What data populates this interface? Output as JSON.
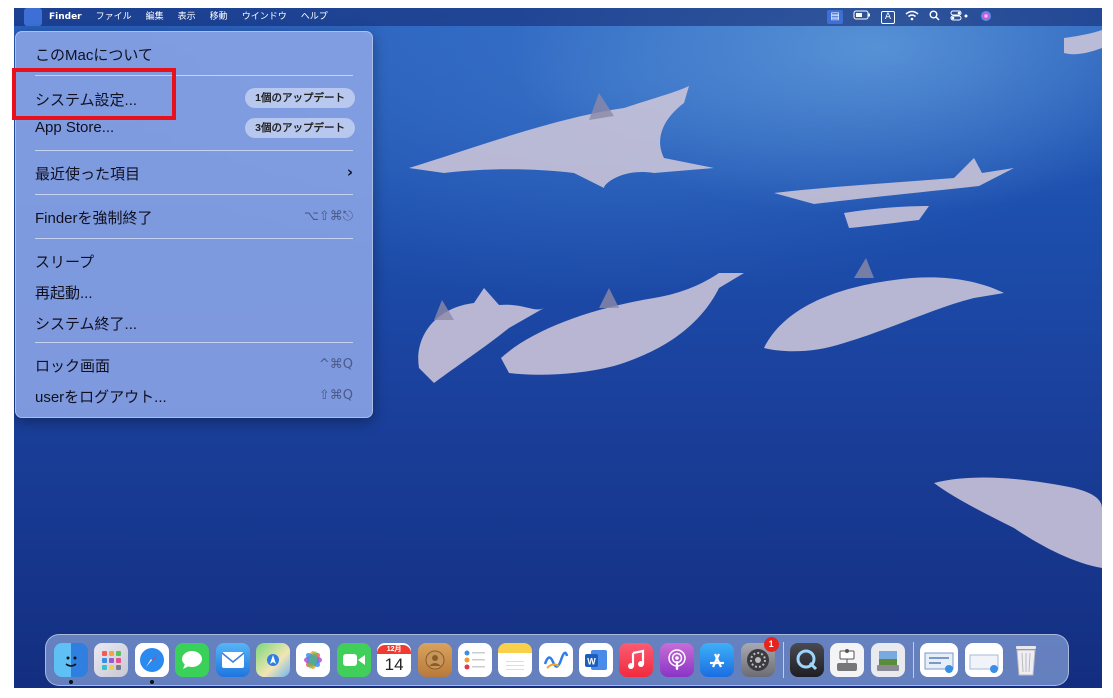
{
  "menubar": {
    "apple_icon": "",
    "items": [
      "Finder",
      "ファイル",
      "編集",
      "表示",
      "移動",
      "ウインドウ",
      "ヘルプ"
    ],
    "status_icons": [
      "screen-mirroring-icon",
      "battery-icon",
      "input-source-icon",
      "wifi-icon",
      "spotlight-search-icon",
      "control-center-icon",
      "siri-icon"
    ],
    "input_source_label": "A"
  },
  "apple_menu": {
    "about": "このMacについて",
    "system_settings": "システム設定...",
    "system_settings_badge": "1個のアップデート",
    "app_store": "App Store...",
    "app_store_badge": "3個のアップデート",
    "recent_items": "最近使った項目",
    "force_quit": "Finderを強制終了",
    "force_quit_shortcut": "⌥⇧⌘⎋",
    "sleep": "スリープ",
    "restart": "再起動...",
    "shutdown": "システム終了...",
    "lock_screen": "ロック画面",
    "lock_screen_shortcut": "^⌘Q",
    "logout": "userをログアウト...",
    "logout_shortcut": "⇧⌘Q"
  },
  "dock": {
    "calendar_month": "12月",
    "calendar_day": "14",
    "system_settings_badge": "1",
    "word_label": "W",
    "apps": [
      "Finder",
      "Launchpad",
      "Safari",
      "Messages",
      "Mail",
      "Maps",
      "Photos",
      "FaceTime",
      "Calendar",
      "Contacts",
      "Reminders",
      "Notes",
      "Freeform",
      "Microsoft Word",
      "Music",
      "Podcasts",
      "App Store",
      "System Settings",
      "QuickTime Player",
      "Image Capture",
      "Preview",
      "Downloads",
      "Documents",
      "Trash"
    ]
  },
  "colors": {
    "highlight": "#e8101a",
    "ocean": "#1d4fae",
    "menu_bg": "#8ca5e6"
  }
}
